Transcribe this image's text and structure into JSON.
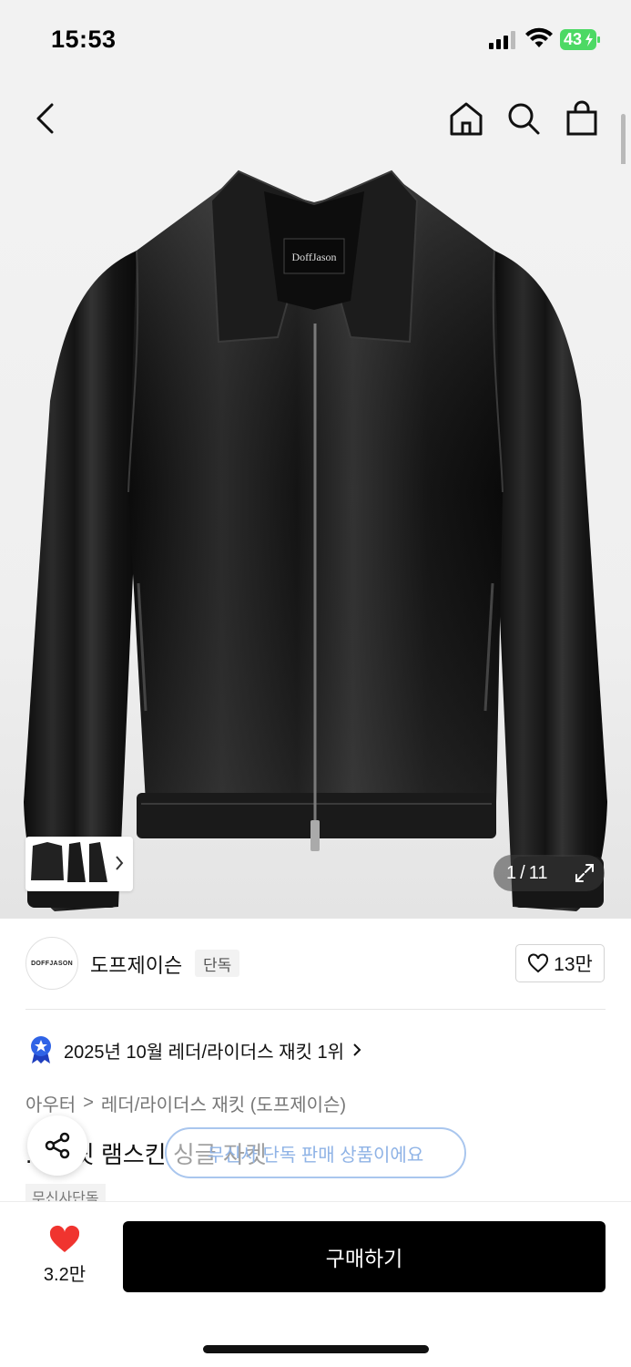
{
  "status_bar": {
    "time": "15:53",
    "battery": "43"
  },
  "image": {
    "current": "1",
    "separator": "/",
    "total": "11",
    "logo_text": "DoffJason"
  },
  "brand": {
    "logo_text": "DOFFJASON",
    "name": "도프제이슨",
    "tag": "단독",
    "likes": "13만"
  },
  "ranking": {
    "text": "2025년 10월 레더/라이더스 재킷 1위"
  },
  "category": {
    "level1": "아우터",
    "separator": ">",
    "level2": "레더/라이더스 재킷 (도프제이슨)"
  },
  "product": {
    "title_visible": "핏 램스킨 싱글 자켓",
    "title_prefix": "..",
    "tag": "무신사단독"
  },
  "toast": {
    "text": "무신사 단독 판매 상품이에요"
  },
  "bottom": {
    "wish_count": "3.2만",
    "buy_label": "구매하기"
  },
  "colors": {
    "accent_blue": "#2f63e6",
    "heart_red": "#f0342f",
    "buy_bg": "#000000"
  }
}
